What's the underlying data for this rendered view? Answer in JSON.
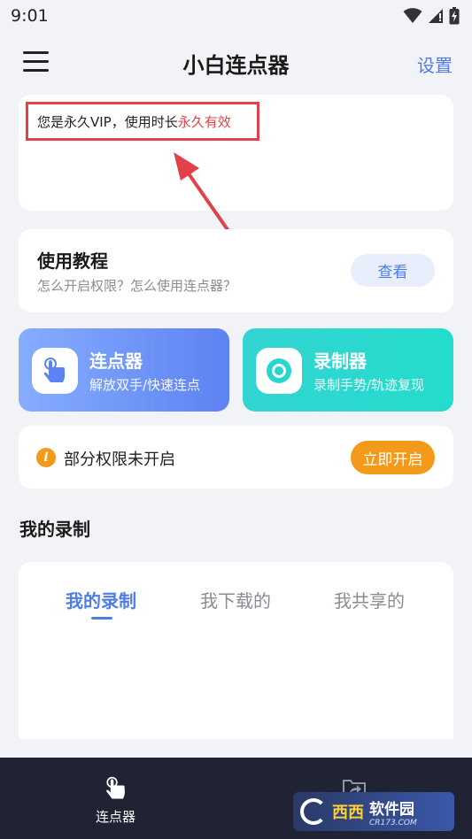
{
  "status_bar": {
    "time": "9:01"
  },
  "header": {
    "title": "小白连点器",
    "settings_label": "设置",
    "menu_icon": "hamburger-menu-icon"
  },
  "vip": {
    "prefix": "您是永久VIP，使用时长",
    "highlight": "永久有效",
    "highlight_color": "#e0414a"
  },
  "tutorial": {
    "title": "使用教程",
    "subtitle": "怎么开启权限？怎么使用连点器？",
    "button_label": "查看"
  },
  "features": [
    {
      "title": "连点器",
      "subtitle": "解放双手/快速连点",
      "icon": "tap-hand-icon",
      "color": "#6a8ff5"
    },
    {
      "title": "录制器",
      "subtitle": "录制手势/轨迹复现",
      "icon": "record-circle-icon",
      "color": "#26d6cf"
    }
  ],
  "permission": {
    "text": "部分权限未开启",
    "button_label": "立即开启",
    "icon": "info-icon",
    "accent": "#f39a1b"
  },
  "recordings": {
    "section_title": "我的录制",
    "tabs": [
      {
        "label": "我的录制",
        "active": true
      },
      {
        "label": "我下载的",
        "active": false
      },
      {
        "label": "我共享的",
        "active": false
      }
    ]
  },
  "bottom_nav": {
    "items": [
      {
        "label": "连点器",
        "icon": "tap-hand-icon"
      },
      {
        "label": "",
        "icon": "share-icon"
      }
    ]
  },
  "watermark": {
    "brand": "西西",
    "name": "软件园",
    "url": "CR173.COM"
  },
  "accent_color": "#4f7de5"
}
